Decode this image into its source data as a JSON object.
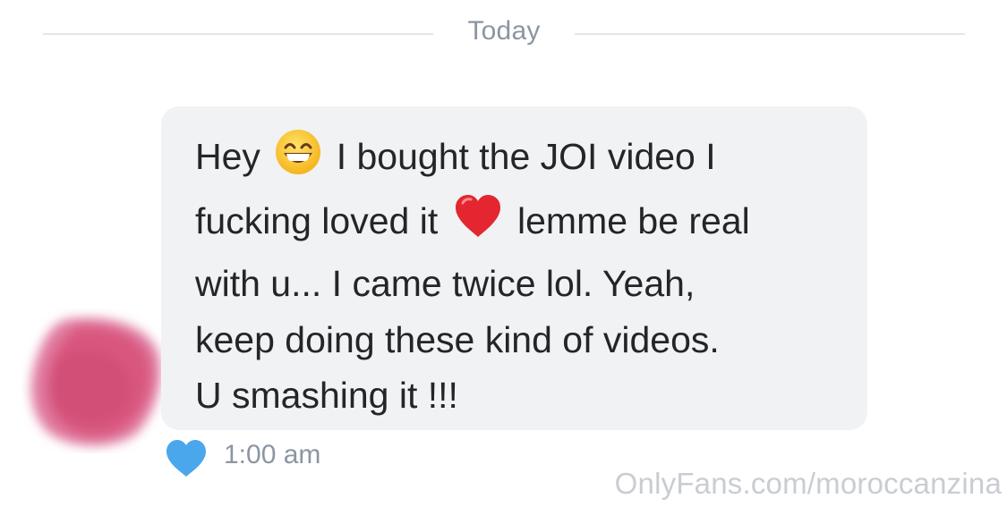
{
  "divider": {
    "label": "Today"
  },
  "message": {
    "segments": [
      {
        "type": "text",
        "value": "Hey "
      },
      {
        "type": "emoji",
        "name": "grinning-face-emoji"
      },
      {
        "type": "text",
        "value": " I bought the JOI video I\nfucking loved it "
      },
      {
        "type": "emoji",
        "name": "red-heart-emoji"
      },
      {
        "type": "text",
        "value": " lemme be real\nwith u... I came twice lol. Yeah,\nkeep doing these kind of videos.\nU smashing it !!!"
      }
    ],
    "time": "1:00 am",
    "liked": true
  },
  "colors": {
    "bubble_bg": "#f1f2f4",
    "text": "#242529",
    "meta_text": "#8a96a3",
    "like_heart": "#4aa7ec",
    "avatar_blur": "#d9577f"
  },
  "watermark": {
    "text": "OnlyFans.com/moroccanzina"
  }
}
